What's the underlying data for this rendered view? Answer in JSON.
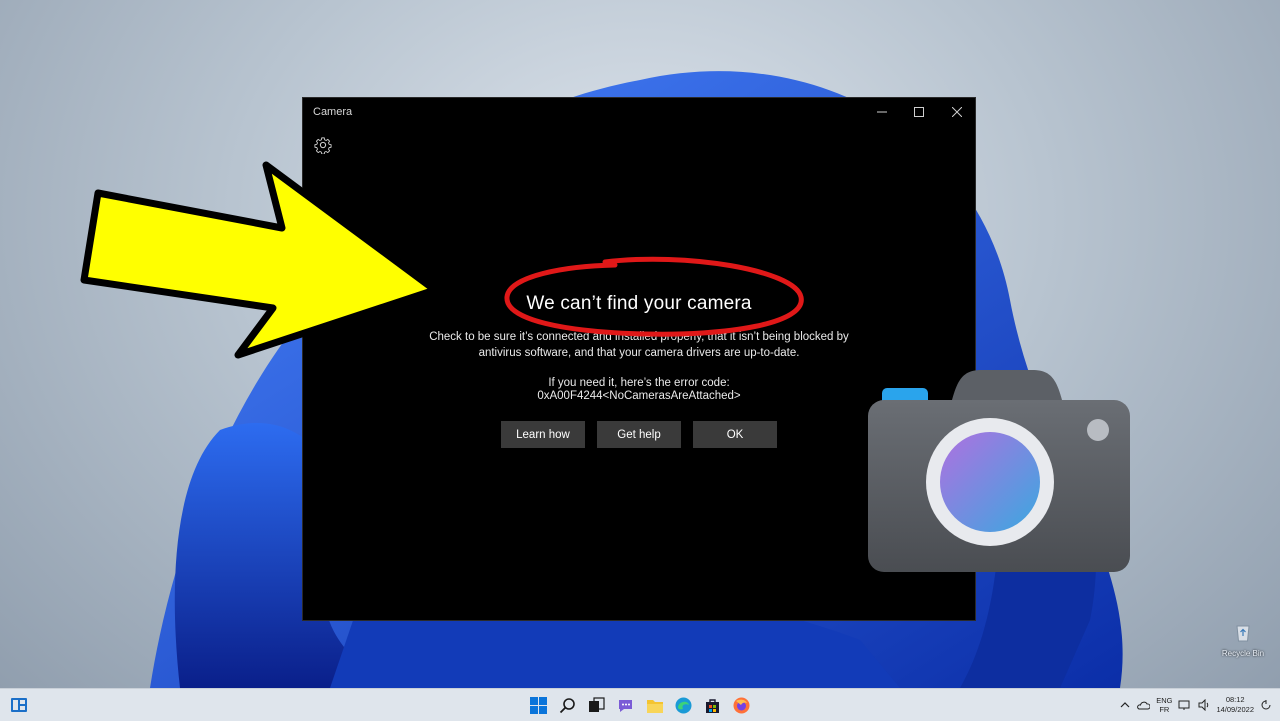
{
  "window": {
    "title": "Camera",
    "error_title": "We can’t find your camera",
    "description": "Check to be sure it’s connected and installed properly, that it isn’t being blocked by antivirus software, and that your camera drivers are up-to-date.",
    "error_code_label": "If you need it, here’s the error code:",
    "error_code": "0xA00F4244<NoCamerasAreAttached>",
    "buttons": {
      "learn_how": "Learn how",
      "get_help": "Get help",
      "ok": "OK"
    }
  },
  "desktop": {
    "recycle_bin_label": "Recycle Bin"
  },
  "taskbar": {
    "language": "ENG",
    "layout": "FR",
    "time": "08:12",
    "date": "14/09/2022"
  },
  "colors": {
    "window_bg": "#000000",
    "button_bg": "#3a3a3a",
    "arrow_fill": "#ffff00",
    "circle_stroke": "#e01818",
    "taskbar_bg": "#dfe5ec"
  }
}
